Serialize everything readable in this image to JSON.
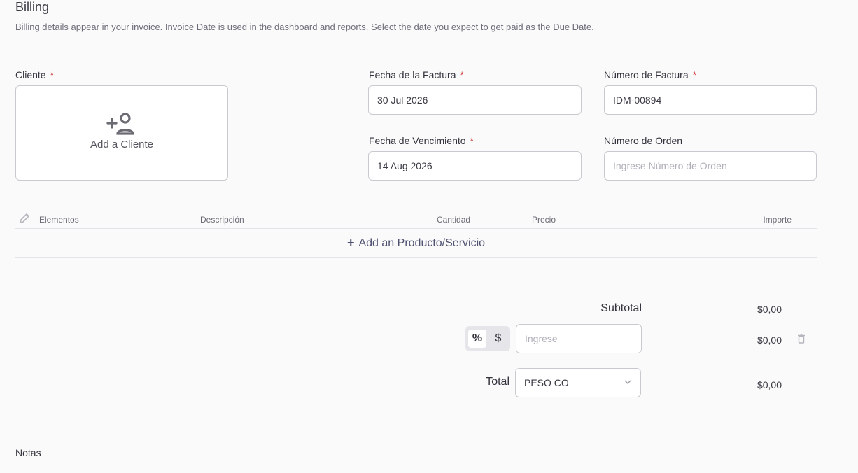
{
  "section": {
    "title": "Billing",
    "description": "Billing details appear in your invoice. Invoice Date is used in the dashboard and reports. Select the date you expect to get paid as the Due Date."
  },
  "client": {
    "label": "Cliente",
    "required_mark": "*",
    "add_label": "Add a Cliente"
  },
  "invoice_date": {
    "label": "Fecha de la Factura",
    "required_mark": "*",
    "value": "30 Jul 2026"
  },
  "invoice_number": {
    "label": "Número de Factura",
    "required_mark": "*",
    "value": "IDM-00894"
  },
  "due_date": {
    "label": "Fecha de Vencimiento",
    "required_mark": "*",
    "value": "14 Aug 2026"
  },
  "order_number": {
    "label": "Número de Orden",
    "placeholder": "Ingrese Número de Orden"
  },
  "table": {
    "headers": {
      "items": "Elementos",
      "description": "Descripción",
      "quantity": "Cantidad",
      "price": "Precio",
      "amount": "Importe"
    },
    "add_row": {
      "plus": "+",
      "label": "Add an Producto/Servicio"
    }
  },
  "totals": {
    "subtotal_label": "Subtotal",
    "subtotal_value": "$0,00",
    "discount_toggle": {
      "percent": "%",
      "dollar": "$",
      "active": "percent"
    },
    "discount_placeholder": "Ingrese",
    "discount_value": "$0,00",
    "total_label": "Total",
    "currency": "PESO CO",
    "total_value": "$0,00"
  },
  "notes": {
    "label": "Notas"
  },
  "colors": {
    "required": "#d23b3b",
    "accent": "#4e5070",
    "border": "#c9c9cf"
  }
}
